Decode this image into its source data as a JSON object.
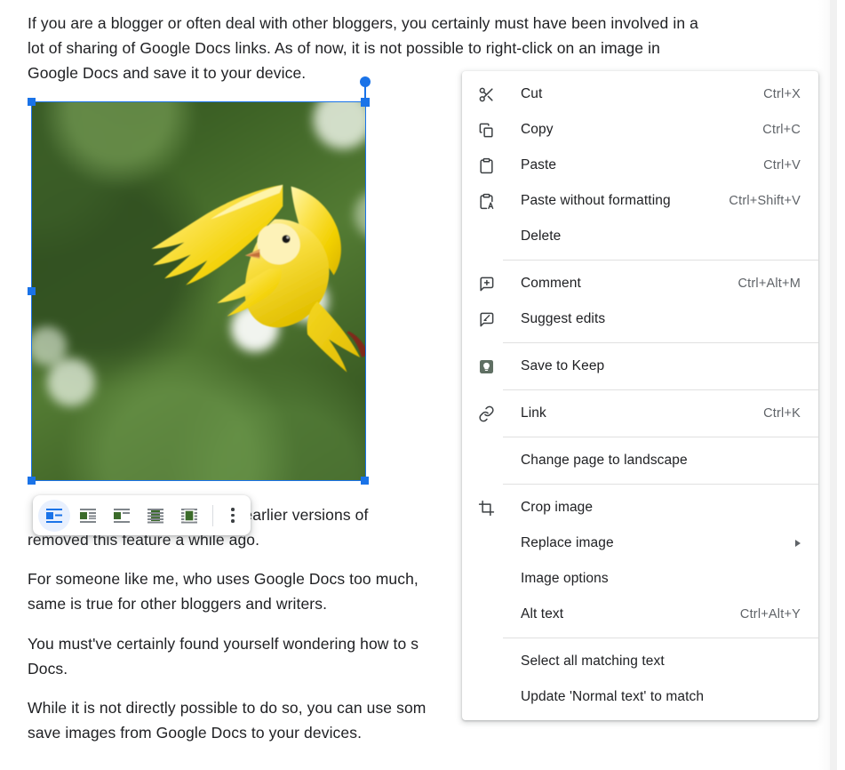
{
  "document": {
    "paragraphs": [
      "If you are a blogger or often deal with other bloggers, you certainly must have been involved in a lot of sharing of Google Docs links. As of now, it is not possible to right-click on an image in Google Docs and save it to your device.",
      "so in earlier versions of",
      "removed this feature a while ago.",
      "For someone like me, who uses Google Docs too much,\nsame is true for other bloggers and writers.",
      "You must've certainly found yourself wondering how to s\nDocs.",
      "While it is not directly possible to do so, you can use som\nsave images from Google Docs to your devices."
    ],
    "image": {
      "alt_description": "Yellow canary bird in flight against blurred green foliage",
      "selected": true
    }
  },
  "image_toolbar": {
    "buttons": [
      {
        "name": "inline-icon",
        "label": "In line",
        "active": true
      },
      {
        "name": "wrap-text-icon",
        "label": "Wrap text",
        "active": false
      },
      {
        "name": "break-text-icon",
        "label": "Break text",
        "active": false
      },
      {
        "name": "behind-text-icon",
        "label": "Behind text",
        "active": false
      },
      {
        "name": "in-front-of-text-icon",
        "label": "In front of text",
        "active": false
      }
    ],
    "more_label": "All image options"
  },
  "context_menu": {
    "groups": [
      {
        "items": [
          {
            "icon": "scissors-icon",
            "label": "Cut",
            "accel": "Ctrl+X",
            "arrow": false
          },
          {
            "icon": "copy-icon",
            "label": "Copy",
            "accel": "Ctrl+C",
            "arrow": false
          },
          {
            "icon": "clipboard-icon",
            "label": "Paste",
            "accel": "Ctrl+V",
            "arrow": false
          },
          {
            "icon": "clipboard-text-icon",
            "label": "Paste without formatting",
            "accel": "Ctrl+Shift+V",
            "arrow": false
          },
          {
            "icon": "none",
            "label": "Delete",
            "accel": "",
            "arrow": false
          }
        ]
      },
      {
        "items": [
          {
            "icon": "comment-icon",
            "label": "Comment",
            "accel": "Ctrl+Alt+M",
            "arrow": false
          },
          {
            "icon": "suggest-edits-icon",
            "label": "Suggest edits",
            "accel": "",
            "arrow": false
          }
        ]
      },
      {
        "items": [
          {
            "icon": "keep-icon",
            "label": "Save to Keep",
            "accel": "",
            "arrow": false
          }
        ]
      },
      {
        "items": [
          {
            "icon": "link-icon",
            "label": "Link",
            "accel": "Ctrl+K",
            "arrow": false
          }
        ]
      },
      {
        "items": [
          {
            "icon": "none",
            "label": "Change page to landscape",
            "accel": "",
            "arrow": false
          }
        ]
      },
      {
        "items": [
          {
            "icon": "crop-icon",
            "label": "Crop image",
            "accel": "",
            "arrow": false
          },
          {
            "icon": "none",
            "label": "Replace image",
            "accel": "",
            "arrow": true
          },
          {
            "icon": "none",
            "label": "Image options",
            "accel": "",
            "arrow": false
          },
          {
            "icon": "none",
            "label": "Alt text",
            "accel": "Ctrl+Alt+Y",
            "arrow": false
          }
        ]
      },
      {
        "items": [
          {
            "icon": "none",
            "label": "Select all matching text",
            "accel": "",
            "arrow": false
          },
          {
            "icon": "none",
            "label": "Update 'Normal text' to match",
            "accel": "",
            "arrow": false
          }
        ]
      }
    ]
  },
  "colors": {
    "accent": "#1a73e8",
    "text": "#202124",
    "muted": "#5f6368",
    "separator": "#e0e0e0",
    "active_chip": "#e8f0fe",
    "keep_icon": "#5f6f63"
  }
}
